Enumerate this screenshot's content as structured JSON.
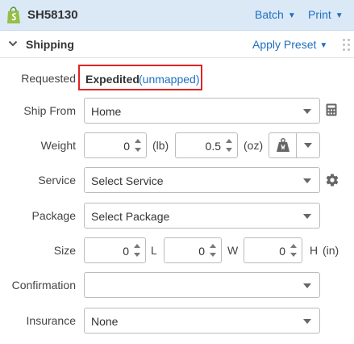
{
  "header": {
    "logo_icon": "shopify-bag-icon",
    "order_id": "SH58130",
    "batch_label": "Batch",
    "print_label": "Print",
    "caret": "▼"
  },
  "section": {
    "title": "Shipping",
    "collapse_icon": "chevron-down-icon",
    "apply_preset_label": "Apply Preset",
    "drag_icon": "drag-handle-icon"
  },
  "requested": {
    "label": "Requested",
    "value": "Expedited",
    "mapping_status": "(unmapped)"
  },
  "ship_from": {
    "label": "Ship From",
    "value": "Home",
    "side_icon": "calculator-icon"
  },
  "weight": {
    "label": "Weight",
    "lb_value": "0",
    "lb_unit": "(lb)",
    "oz_value": "0.5",
    "oz_unit": "(oz)",
    "scale_icon": "scale-weight-icon"
  },
  "service": {
    "label": "Service",
    "value": "Select Service",
    "side_icon": "gear-icon"
  },
  "package": {
    "label": "Package",
    "value": "Select Package"
  },
  "size": {
    "label": "Size",
    "length": "0",
    "length_unit": "L",
    "width": "0",
    "width_unit": "W",
    "height": "0",
    "height_unit": "H",
    "unit": "(in)"
  },
  "confirmation": {
    "label": "Confirmation",
    "value": ""
  },
  "insurance": {
    "label": "Insurance",
    "value": "None"
  },
  "colors": {
    "header_bg": "#dbe9f7",
    "link": "#1f6fbf",
    "highlight_border": "#e02424",
    "shopify_green": "#95bf47"
  }
}
